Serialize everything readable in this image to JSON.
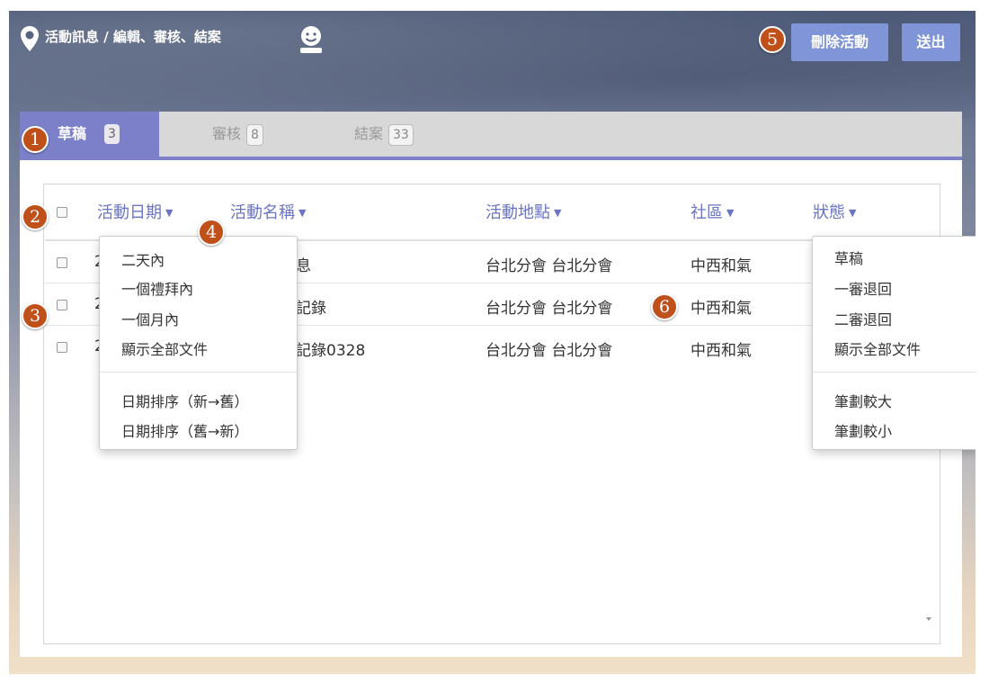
{
  "header": {
    "breadcrumb": "活動訊息 / 編輯、審核、結案",
    "delete_button": "刪除活動",
    "send_button": "送出"
  },
  "tabs": [
    {
      "label": "草稿",
      "count": "3"
    },
    {
      "label": "審核",
      "count": "8"
    },
    {
      "label": "結案",
      "count": "33"
    }
  ],
  "table": {
    "columns": [
      {
        "label": "活動日期"
      },
      {
        "label": "活動名稱"
      },
      {
        "label": "活動地點"
      },
      {
        "label": "社區"
      },
      {
        "label": "狀態"
      }
    ],
    "rows": [
      {
        "date_fragment": "2",
        "name_fragment": "訊息",
        "location": "台北分會 台北分會",
        "community": "中西和氣"
      },
      {
        "date_fragment": "2",
        "name_fragment": "核記錄",
        "location": "台北分會 台北分會",
        "community": "中西和氣"
      },
      {
        "date_fragment": "2",
        "name_fragment": "核記錄0328",
        "location": "台北分會 台北分會",
        "community": "中西和氣"
      }
    ]
  },
  "date_filter_menu": {
    "items": [
      "二天內",
      "一個禮拜內",
      "一個月內",
      "顯示全部文件"
    ],
    "sort_items": [
      "日期排序（新→舊）",
      "日期排序（舊→新）"
    ]
  },
  "status_filter_menu": {
    "items": [
      "草稿",
      "一審退回",
      "二審退回",
      "顯示全部文件"
    ],
    "stroke_items": [
      "筆劃較大",
      "筆劃較小"
    ]
  },
  "annotations": [
    "1",
    "2",
    "3",
    "4",
    "5",
    "6"
  ],
  "colors": {
    "accent": "#7b80c8",
    "button": "#7f95d8",
    "marker": "#c0501a"
  }
}
